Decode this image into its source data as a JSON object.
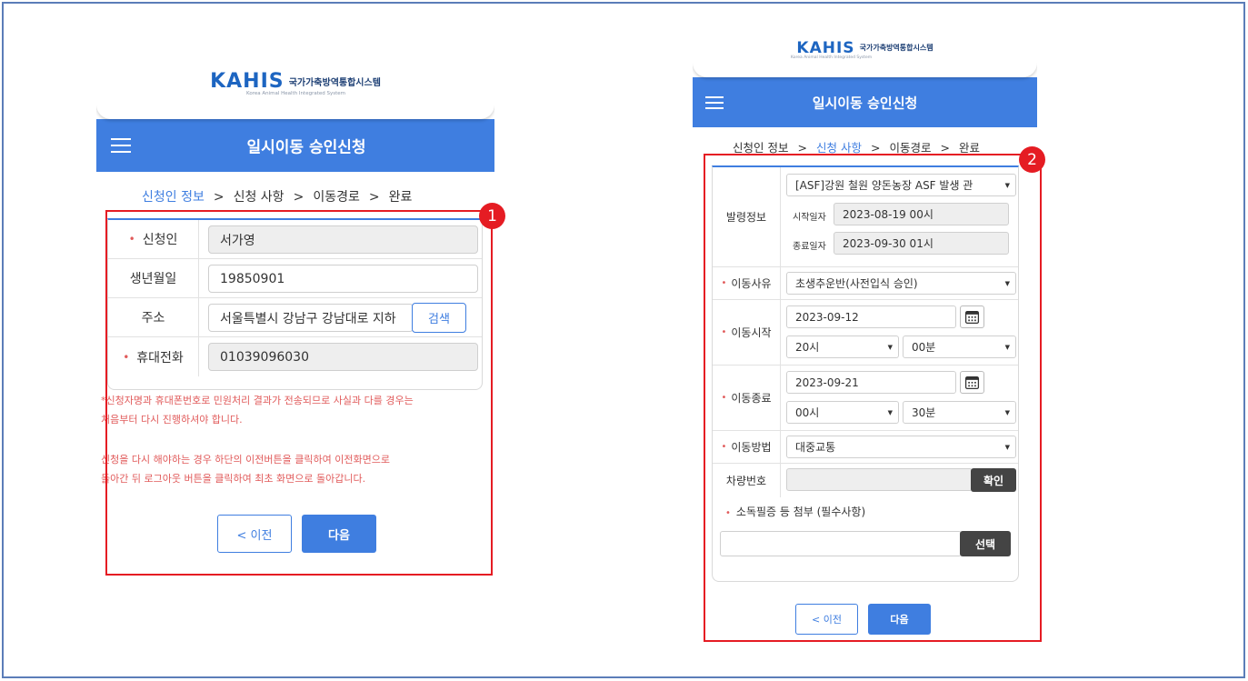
{
  "brand": {
    "logo_mark": "KAHIS",
    "logo_title": "국가가축방역통합시스템",
    "logo_subtitle": "Korea Animal Health Integrated System"
  },
  "screen1": {
    "title": "일시이동 승인신청",
    "steps": [
      "신청인 정보",
      "신청 사항",
      "이동경로",
      "완료"
    ],
    "active_step": 0,
    "fields": {
      "applicant": {
        "label": "신청인",
        "value": "서가영",
        "required": true
      },
      "birth": {
        "label": "생년월일",
        "value": "19850901",
        "required": false
      },
      "address": {
        "label": "주소",
        "value": "서울특별시 강남구 강남대로 지하",
        "required": false,
        "button": "검색"
      },
      "phone": {
        "label": "휴대전화",
        "value": "01039096030",
        "required": true
      }
    },
    "notice1_line1": "*신청자명과 휴대폰번호로 민원처리 결과가 전송되므로 사실과 다를 경우는",
    "notice1_line2": "처음부터 다시 진행하셔야 합니다.",
    "notice2_line1": "신청을 다시 해야하는 경우 하단의 이전버튼을 클릭하여 이전화면으로",
    "notice2_line2": "돌아간 뒤 로그아웃 버튼을 클릭하여 최초 화면으로 돌아갑니다.",
    "prev_label": "< 이전",
    "next_label": "다음"
  },
  "screen2": {
    "title": "일시이동 승인신청",
    "steps": [
      "신청인 정보",
      "신청 사항",
      "이동경로",
      "완료"
    ],
    "active_step": 1,
    "order": {
      "label": "발령정보",
      "select_value": "[ASF]강원 철원 양돈농장 ASF 발생 관",
      "start_label": "시작일자",
      "start_value": "2023-08-19 00시",
      "end_label": "종료일자",
      "end_value": "2023-09-30 01시"
    },
    "reason": {
      "label": "이동사유",
      "value": "초생추운반(사전입식 승인)",
      "required": true
    },
    "move_start": {
      "label": "이동시작",
      "date": "2023-09-12",
      "hour": "20시",
      "minute": "00분",
      "required": true
    },
    "move_end": {
      "label": "이동종료",
      "date": "2023-09-21",
      "hour": "00시",
      "minute": "30분",
      "required": true
    },
    "method": {
      "label": "이동방법",
      "value": "대중교통",
      "required": true
    },
    "vehicle": {
      "label": "차량번호",
      "value": "",
      "button": "확인"
    },
    "attachment": {
      "label": "소독필증 등 첨부 (필수사항)",
      "value": "",
      "button": "선택",
      "required": true
    },
    "prev_label": "< 이전",
    "next_label": "다음"
  },
  "annotations": {
    "badge1": "1",
    "badge2": "2",
    "color": "#e51c23"
  },
  "colors": {
    "primary": "#3f7ee0",
    "required": "#e15b5b",
    "frame": "#5b7db8"
  }
}
